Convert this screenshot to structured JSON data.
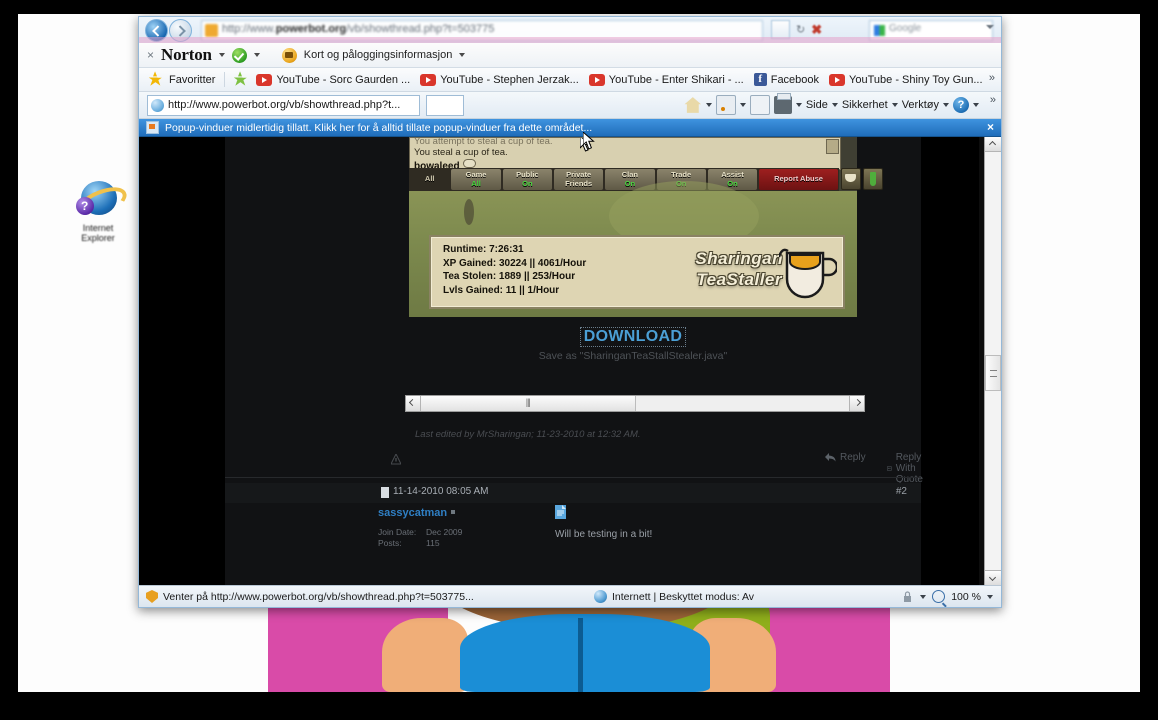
{
  "browser": {
    "top_url_prefix": "http://www.",
    "top_url_domain": "powerbot.org",
    "top_url_suffix": "/vb/showthread.php?t=503775",
    "search_placeholder": "Google",
    "norton": {
      "brand": "Norton",
      "close_label": "×",
      "safe_label": "",
      "card_label": "Kort og påloggingsinformasjon",
      "caret": "▾"
    },
    "favorites": {
      "label": "Favoritter",
      "items": [
        {
          "icon": "youtube-icon",
          "label": "YouTube - Sorc Gaurden ..."
        },
        {
          "icon": "youtube-icon",
          "label": "YouTube - Stephen Jerzak..."
        },
        {
          "icon": "youtube-icon",
          "label": "YouTube - Enter Shikari - ..."
        },
        {
          "icon": "facebook-icon",
          "label": "Facebook"
        },
        {
          "icon": "youtube-icon",
          "label": "YouTube - Shiny Toy Gun..."
        }
      ],
      "overflow": "»"
    },
    "address": {
      "url": "http://www.powerbot.org/vb/showthread.php?t...",
      "commands": [
        {
          "icon": "home-icon",
          "label": ""
        },
        {
          "icon": "feeds-icon",
          "label": ""
        },
        {
          "icon": "read-mail-icon",
          "label": ""
        },
        {
          "icon": "print-icon",
          "label": ""
        },
        {
          "icon": "page-menu",
          "label": "Side"
        },
        {
          "icon": "safety-menu",
          "label": "Sikkerhet"
        },
        {
          "icon": "tools-menu",
          "label": "Verktøy"
        },
        {
          "icon": "help-icon",
          "label": ""
        }
      ],
      "overflow": "»"
    },
    "popup_bar": {
      "message": "Popup-vinduer midlertidig tillatt. Klikk her for å alltid tillate popup-vinduer fra dette området...",
      "close": "×"
    },
    "status": {
      "loading": "Venter på http://www.powerbot.org/vb/showthread.php?t=503775...",
      "zone": "Internett | Beskyttet modus: Av",
      "zoom": "100 %",
      "caret": "▾"
    }
  },
  "game": {
    "chat": {
      "line_partial": "You attempt to steal a cup of tea.",
      "line_current": "You steal a cup of tea.",
      "player_name": "bowaleed"
    },
    "tabs": [
      {
        "name": "All",
        "state": ""
      },
      {
        "name": "Game",
        "state": "All"
      },
      {
        "name": "Public",
        "state": "On"
      },
      {
        "name": "Private",
        "state": "Friends"
      },
      {
        "name": "Clan",
        "state": "On"
      },
      {
        "name": "Trade",
        "state": "On"
      },
      {
        "name": "Assist",
        "state": "On"
      },
      {
        "name": "Report Abuse",
        "state": ""
      }
    ],
    "stats": {
      "runtime": "Runtime: 7:26:31",
      "xp": "XP Gained: 30224 || 4061/Hour",
      "tea": "Tea Stolen: 1889 || 253/Hour",
      "lvls": "Lvls Gained: 11 || 1/Hour"
    },
    "brand_line1": "Sharingan",
    "brand_line2": "TeaStaller"
  },
  "thread": {
    "download_label": "DOWNLOAD",
    "download_sub": "Save as \"SharinganTeaStallStealer.java\"",
    "last_edited": "Last edited by MrSharingan; 11-23-2010 at 12:32 AM.",
    "actions": [
      {
        "label": "Reply",
        "icon": "reply-icon"
      },
      {
        "label": "Reply With Quote",
        "icon": "quote-icon"
      },
      {
        "label": "",
        "icon": "multiquote-icon"
      }
    ],
    "post2": {
      "date": "11-14-2010 08:05 AM",
      "number": "#2",
      "user": "sassycatman",
      "join_label": "Join Date:",
      "join_value": "Dec 2009",
      "posts_label": "Posts:",
      "posts_value": "115",
      "message": "Will be testing in a bit!"
    }
  },
  "desktop": {
    "icon_label_line1": "Internet",
    "icon_label_line2": "Explorer"
  }
}
